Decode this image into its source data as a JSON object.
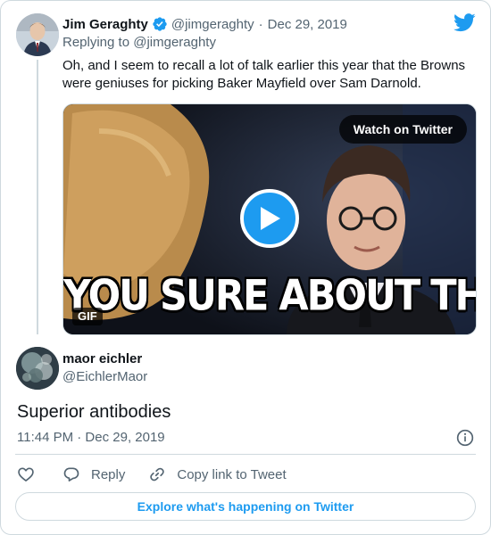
{
  "parent_tweet": {
    "author_name": "Jim Geraghty",
    "handle": "@jimgeraghty",
    "separator": "·",
    "date": "Dec 29, 2019",
    "replying_to": "Replying to @jimgeraghty",
    "text": "Oh, and I seem to recall a lot of talk earlier this year that the Browns were geniuses for picking Baker Mayfield over Sam Darnold.",
    "media": {
      "watch_label": "Watch on Twitter",
      "caption": "YOU SURE ABOUT THAT?",
      "badge": "GIF"
    }
  },
  "main_tweet": {
    "author_name": "maor eichler",
    "handle": "@EichlerMaor",
    "text": "Superior antibodies",
    "timestamp": "11:44 PM · Dec 29, 2019"
  },
  "actions": {
    "reply_label": "Reply",
    "copy_link_label": "Copy link to Tweet"
  },
  "explore_label": "Explore what's happening on Twitter",
  "icons": {
    "brand": "twitter-bird-icon",
    "verified": "verified-badge-icon",
    "play": "play-icon",
    "info": "info-icon",
    "like": "heart-icon",
    "reply": "reply-bubble-icon",
    "link": "link-icon"
  },
  "colors": {
    "accent": "#1d9bf0",
    "text_primary": "#0f1419",
    "text_secondary": "#536471",
    "border": "#cfd9de"
  }
}
